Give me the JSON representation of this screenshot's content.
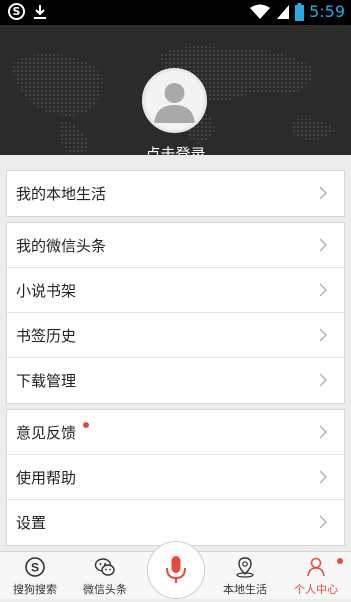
{
  "status_bar": {
    "time": "5:59"
  },
  "header": {
    "login_label": "点击登录"
  },
  "groups": [
    {
      "items": [
        {
          "label": "我的本地生活"
        }
      ]
    },
    {
      "items": [
        {
          "label": "我的微信头条"
        },
        {
          "label": "小说书架"
        },
        {
          "label": "书签历史"
        },
        {
          "label": "下载管理"
        }
      ]
    },
    {
      "items": [
        {
          "label": "意见反馈"
        },
        {
          "label": "使用帮助"
        },
        {
          "label": "设置"
        }
      ]
    }
  ],
  "tabs": [
    {
      "label": "搜狗搜索"
    },
    {
      "label": "微信头条"
    },
    {
      "label": "本地生活"
    },
    {
      "label": "个人中心"
    }
  ],
  "colors": {
    "accent": "#e84a3c",
    "status_time": "#2aa8e0",
    "header_bg": "#2b2b2c"
  }
}
